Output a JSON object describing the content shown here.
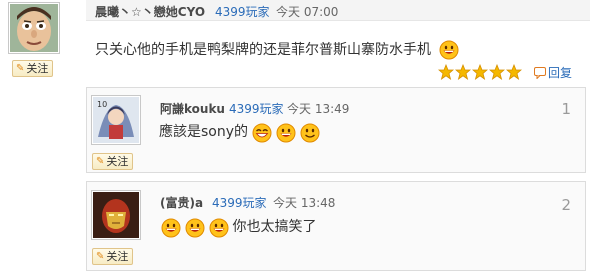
{
  "post": {
    "username": "晨曦丶☆丶戀她CYO",
    "site": "4399玩家",
    "time": "今天 07:00",
    "follow_label": "关注",
    "text": "只关心他的手机是鸭梨牌的还是菲尔普斯山寨防水手机",
    "rating_stars": 5,
    "reply_label": "回复"
  },
  "replies": [
    {
      "username": "阿謙kouku",
      "site": "4399玩家",
      "time": "今天 13:49",
      "text": "應該是sony的",
      "floor": "1",
      "follow_label": "关注"
    },
    {
      "username": "(富贵)a",
      "site": "4399玩家",
      "time": "今天 13:48",
      "text": "你也太搞笑了",
      "floor": "2",
      "follow_label": "关注"
    }
  ],
  "colors": {
    "link": "#2a6bb8",
    "star": "#f5b800",
    "border": "#dcdcdc"
  }
}
